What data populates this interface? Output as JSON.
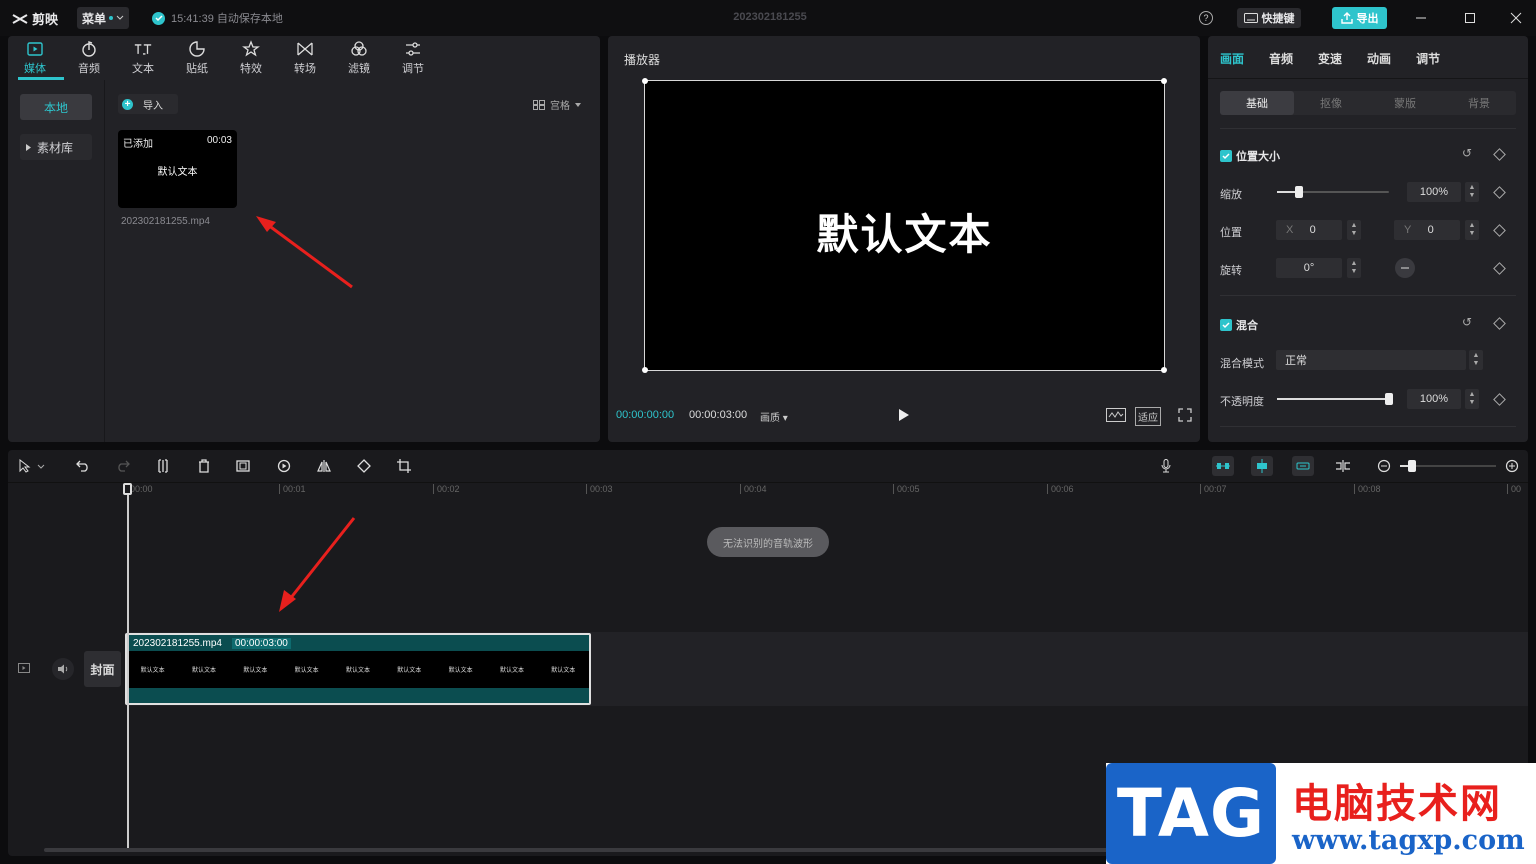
{
  "app": {
    "name": "剪映",
    "menu_label": "菜单",
    "autosave": "15:41:39 自动保存本地",
    "project_title": "202302181255",
    "help": "?",
    "shortcut_label": "快捷键",
    "export_label": "导出"
  },
  "media": {
    "tabs": [
      {
        "label": "媒体",
        "icon": "media-icon"
      },
      {
        "label": "音频",
        "icon": "audio-icon"
      },
      {
        "label": "文本",
        "icon": "text-icon"
      },
      {
        "label": "贴纸",
        "icon": "sticker-icon"
      },
      {
        "label": "特效",
        "icon": "effects-icon"
      },
      {
        "label": "转场",
        "icon": "transition-icon"
      },
      {
        "label": "滤镜",
        "icon": "filter-icon"
      },
      {
        "label": "调节",
        "icon": "adjust-icon"
      }
    ],
    "sidebar": [
      {
        "label": "本地"
      },
      {
        "label": "素材库"
      }
    ],
    "import_label": "导入",
    "view_label": "宫格",
    "item": {
      "added": "已添加",
      "duration": "00:03",
      "preview_text": "默认文本",
      "filename": "202302181255.mp4"
    }
  },
  "player": {
    "title": "播放器",
    "screen_text": "默认文本",
    "current_time": "00:00:00:00",
    "total_time": "00:00:03:00",
    "quality": "画质",
    "fit": "适应"
  },
  "inspector": {
    "tabs": [
      "画面",
      "音频",
      "变速",
      "动画",
      "调节"
    ],
    "subtabs": [
      "基础",
      "抠像",
      "蒙版",
      "背景"
    ],
    "position_size": {
      "title": "位置大小",
      "scale_label": "缩放",
      "scale_value": "100%",
      "scale_level": 0.2,
      "position_label": "位置",
      "x_label": "X",
      "x_value": "0",
      "y_label": "Y",
      "y_value": "0",
      "rotate_label": "旋转",
      "rotate_value": "0°"
    },
    "blend": {
      "title": "混合",
      "mode_label": "混合模式",
      "mode_value": "正常",
      "opacity_label": "不透明度",
      "opacity_value": "100%",
      "opacity_level": 1.0
    }
  },
  "timeline": {
    "ruler": [
      "00:00",
      "00:01",
      "00:02",
      "00:03",
      "00:04",
      "00:05",
      "00:06",
      "00:07",
      "00:08",
      "00"
    ],
    "audio_notice": "无法识别的音轨波形",
    "cover_label": "封面",
    "clip": {
      "name": "202302181255.mp4",
      "duration": "00:00:03:00",
      "frame_text": "默认文本"
    }
  },
  "watermark": {
    "tag": "TAG",
    "cn": "电脑技术网",
    "url": "www.tagxp.com"
  },
  "colors": {
    "accent": "#2ec4cc",
    "annotation": "#e8201d",
    "clip": "#0b4d50"
  }
}
